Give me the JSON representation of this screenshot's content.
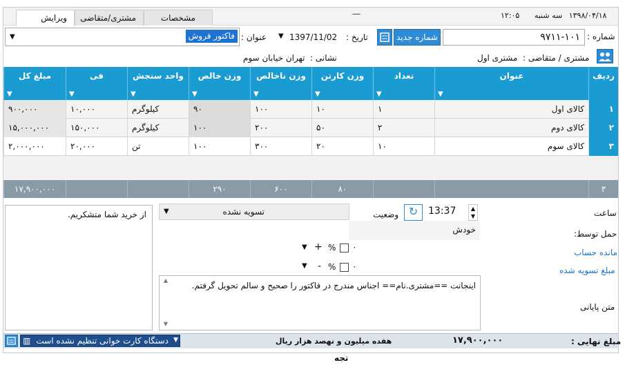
{
  "tabs": [
    {
      "label": "ویرایش"
    },
    {
      "label": "مشتری/متقاضی"
    },
    {
      "label": "مشخصات"
    }
  ],
  "topbar": {
    "time": "۱۲:۰۵",
    "day": "سه شنبه",
    "date": "۱۳۹۸/۰۴/۱۸",
    "dash": "—"
  },
  "header": {
    "number_label": "شماره :",
    "number_value": "۹۷۱۱-۱۰۱",
    "new_number_button": "شماره جدید",
    "date_label": "تاریخ :",
    "date_value": "1397/11/02",
    "title_label": "عنوان :",
    "title_value": "فاکتور فروش",
    "customer_label": "مشتری / متقاضی :",
    "customer_value": "مشتری اول",
    "address_label": "نشانی :",
    "address_value": "تهران خیابان سوم"
  },
  "grid": {
    "columns": [
      "ردیف",
      "عنوان",
      "تعداد",
      "وزن کارتن",
      "وزن ناخالص",
      "وزن خالص",
      "واحد سنجش",
      "فی",
      "مبلغ کل"
    ],
    "rows": [
      {
        "rn": "۱",
        "title": "کالای اول",
        "qty": "۱",
        "carton": "۱۰",
        "gross": "۱۰۰",
        "net": "۹۰",
        "unit": "کیلوگرم",
        "price": "۱۰,۰۰۰",
        "total": "۹۰۰,۰۰۰"
      },
      {
        "rn": "۲",
        "title": "کالای دوم",
        "qty": "۲",
        "carton": "۵۰",
        "gross": "۲۰۰",
        "net": "۱۰۰",
        "unit": "کیلوگرم",
        "price": "۱۵۰,۰۰۰",
        "total": "۱۵,۰۰۰,۰۰۰"
      },
      {
        "rn": "۳",
        "title": "کالای سوم",
        "qty": "۱۰",
        "carton": "۲۰",
        "gross": "۳۰۰",
        "net": "۱۰۰",
        "unit": "تن",
        "price": "۲۰,۰۰۰",
        "total": "۲,۰۰۰,۰۰۰"
      }
    ],
    "summary": {
      "count": "۳",
      "carton": "۸۰",
      "gross": "۶۰۰",
      "net": "۲۹۰",
      "total": "۱۷,۹۰۰,۰۰۰"
    }
  },
  "bottom": {
    "hour_label": "ساعت",
    "carried_by_label": "حمل توسط:",
    "balance_label": "مانده حساب",
    "settled_label": "مبلغ تسویه شده",
    "footer_text_label": "متن پایانی",
    "time_value": "13:37",
    "status_label": "وضعیت",
    "status_value": "تسویه نشده",
    "carried_by_value": "خودش",
    "plus_sign": "+",
    "minus_sign": "-",
    "percent": "%",
    "zero": "۰",
    "footer_text": "اینجانت ==مشتری.نام== اجناس مندرج در فاکتور را صحیح و سالم تحویل گرفتم.",
    "thanks_text": "از خرید شما متشکریم."
  },
  "status": {
    "final_label": "مبلغ نهایی :",
    "final_value": "۱۷,۹۰۰,۰۰۰",
    "words": "هفده میلیون و نهصد  هزار  ریال",
    "card_reader": "دستگاه کارت خوانی تنظیم نشده است"
  },
  "below": {
    "text": "تجه"
  },
  "colors": {
    "grid_header": "#1a9bd1",
    "summary_row": "#8a9ba8",
    "accent_button": "#2f8bd3",
    "link": "#1a73c9"
  }
}
